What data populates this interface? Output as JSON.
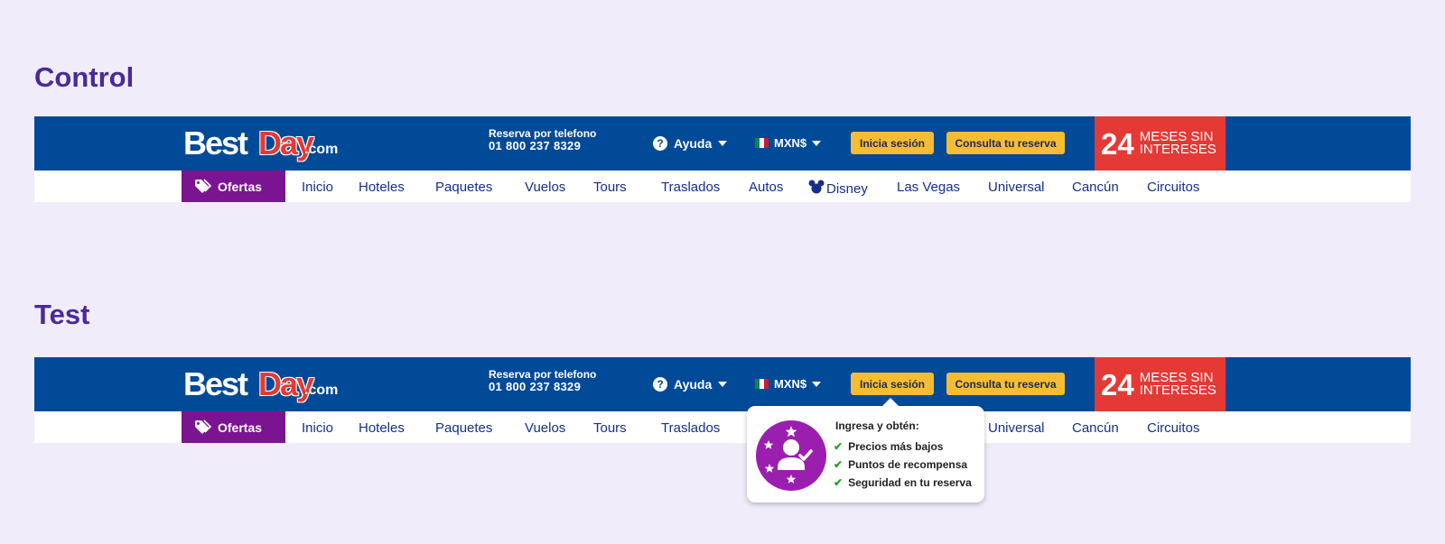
{
  "sections": {
    "control_title": "Control",
    "test_title": "Test"
  },
  "header": {
    "logo": {
      "best": "Best",
      "day": "Day",
      "com": ".com"
    },
    "phone_label": "Reserva por telefono",
    "phone_number": "01 800 237 8329",
    "help_label": "Ayuda",
    "help_icon": "question-circle-icon",
    "currency_label": "MXN$",
    "currency_flag": "mexico-flag-icon",
    "login_label": "Inicia sesión",
    "reservation_label": "Consulta tu reserva",
    "promo_number": "24",
    "promo_line1": "MESES SIN",
    "promo_line2": "INTERESES"
  },
  "nav": {
    "ofertas_label": "Ofertas",
    "items": [
      "Inicio",
      "Hoteles",
      "Paquetes",
      "Vuelos",
      "Tours",
      "Traslados",
      "Autos",
      "Disney",
      "Las Vegas",
      "Universal",
      "Cancún",
      "Circuitos"
    ]
  },
  "popover": {
    "heading": "Ingresa y obtén:",
    "benefits": [
      "Precios más bajos",
      "Puntos de recompensa",
      "Seguridad en tu reserva"
    ]
  },
  "colors": {
    "page_bg": "#f0ecf9",
    "title": "#4a2a9a",
    "header_blue": "#004a98",
    "button_yellow": "#f6bd33",
    "promo_red": "#e53935",
    "ofertas_purple": "#7b1490",
    "nav_text": "#15308a",
    "badge_purple": "#9b1fae",
    "check_green": "#2aa12a"
  }
}
